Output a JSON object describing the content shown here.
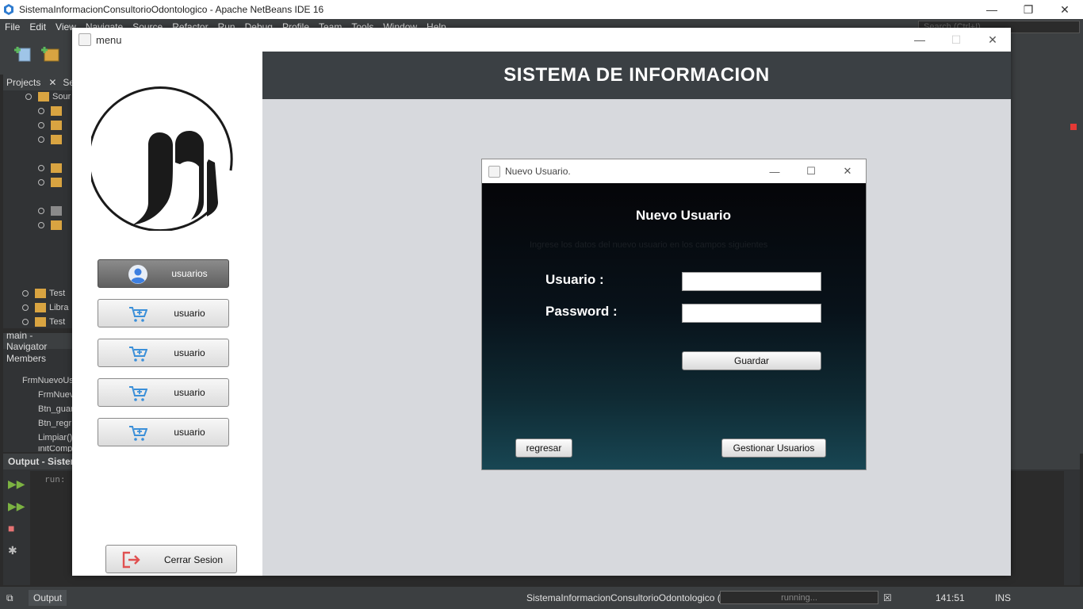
{
  "ide": {
    "title": "SistemaInformacionConsultorioOdontologico - Apache NetBeans IDE 16",
    "menu": [
      "File",
      "Edit",
      "View",
      "Navigate",
      "Source",
      "Refactor",
      "Run",
      "Debug",
      "Profile",
      "Team",
      "Tools",
      "Window",
      "Help"
    ],
    "search_placeholder": "Search (Ctrl+I)",
    "projects_tab": "Projects",
    "services_tab": "Se",
    "tree": [
      "Sour",
      "Test",
      "Libra",
      "Test"
    ],
    "navigator_title": "main - Navigator",
    "members_label": "Members",
    "members": [
      "FrmNuevoUs",
      "FrmNuev",
      "Btn_guar",
      "Btn_regr",
      "Limpiar()",
      "initComp"
    ],
    "output_title": "Output - Sistem",
    "output_text": "run:",
    "output_tab": "Output"
  },
  "status": {
    "project_run": "SistemaInformacionConsultorioOdontologico (run)",
    "progress": "running...",
    "position": "141:51",
    "mode": "INS"
  },
  "menu_frame": {
    "title": "menu",
    "header": "SISTEMA DE INFORMACION",
    "sidebar": {
      "buttons": [
        {
          "label": "usuarios",
          "icon": "user-avatar-icon",
          "active": true
        },
        {
          "label": "usuario",
          "icon": "cart-plus-icon",
          "active": false
        },
        {
          "label": "usuario",
          "icon": "cart-plus-icon",
          "active": false
        },
        {
          "label": "usuario",
          "icon": "cart-plus-icon",
          "active": false
        },
        {
          "label": "usuario",
          "icon": "cart-plus-icon",
          "active": false
        }
      ],
      "logout_label": "Cerrar Sesion"
    }
  },
  "dialog": {
    "title": "Nuevo Usuario.",
    "heading": "Nuevo Usuario",
    "hint_text": "Ingrese los datos del nuevo usuario en los campos siguientes",
    "usuario_label": "Usuario :",
    "usuario_value": "",
    "password_label": "Password :",
    "password_value": "",
    "guardar_label": "Guardar",
    "regresar_label": "regresar",
    "gestionar_label": "Gestionar Usuarios"
  },
  "colors": {
    "header_bg": "#3b4044",
    "content_bg": "#d7d9dd",
    "dialog_gradient_top": "#050508",
    "dialog_gradient_bottom": "#184653",
    "ide_dark": "#3c3f41"
  }
}
